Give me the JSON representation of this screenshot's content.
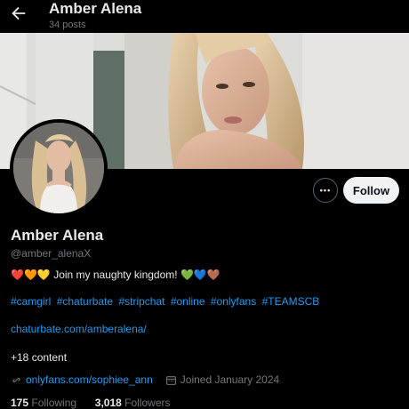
{
  "header": {
    "name": "Amber Alena",
    "posts": "34 posts"
  },
  "profile": {
    "name": "Amber Alena",
    "handle": "@amber_alenaX",
    "bio_hearts_left": [
      "❤️",
      "🧡",
      "💛"
    ],
    "bio_text": "Join my naughty kingdom!",
    "bio_hearts_right": [
      "💚",
      "💙",
      "🤎"
    ],
    "hashtags": [
      "#camgirl",
      "#chaturbate",
      "#stripchat",
      "#online",
      "#onlyfans",
      "#TEAMSCB"
    ],
    "website": "chaturbate.com/amberalena/",
    "content_count": "+18 content",
    "link": "onlyfans.com/sophiee_ann",
    "joined": "Joined January 2024"
  },
  "actions": {
    "more": "•••",
    "follow": "Follow"
  },
  "stats": {
    "following_count": "175",
    "following_label": "Following",
    "followers_count": "3,018",
    "followers_label": "Followers"
  },
  "colors": {
    "accent": "#1d9bf0",
    "muted": "#71767b",
    "text": "#e7e9ea",
    "bg": "#000000"
  }
}
